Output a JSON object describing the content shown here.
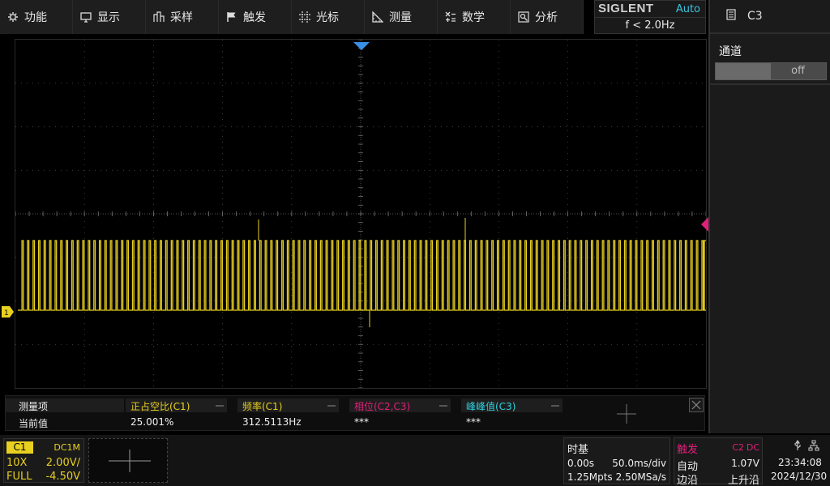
{
  "menu": {
    "items": [
      {
        "label": "功能",
        "icon": "gear-icon"
      },
      {
        "label": "显示",
        "icon": "monitor-icon"
      },
      {
        "label": "采样",
        "icon": "acquire-icon"
      },
      {
        "label": "触发",
        "icon": "flag-icon"
      },
      {
        "label": "光标",
        "icon": "cursor-icon"
      },
      {
        "label": "测量",
        "icon": "ruler-icon"
      },
      {
        "label": "数学",
        "icon": "math-icon"
      },
      {
        "label": "分析",
        "icon": "analysis-icon"
      }
    ]
  },
  "status": {
    "brand": "SIGLENT",
    "acq_mode": "Auto",
    "frequency": "f < 2.0Hz"
  },
  "right_panel": {
    "title": "C3",
    "icon": "document-icon",
    "section_label": "通道",
    "toggle_value": "off"
  },
  "colors": {
    "ch1": "#e8d020",
    "ch2": "#e0207a",
    "ch3": "#30d0e0",
    "trigger_marker": "#3a8ee6",
    "grid": "#555555"
  },
  "measurements": {
    "header_label": "测量项",
    "value_label": "当前值",
    "items": [
      {
        "name": "正占空比(C1)",
        "value": "25.001%",
        "color": "#e8d020"
      },
      {
        "name": "频率(C1)",
        "value": "312.5113Hz",
        "color": "#e8d020"
      },
      {
        "name": "相位(C2,C3)",
        "value": "***",
        "color": "#e0207a"
      },
      {
        "name": "峰峰值(C3)",
        "value": "***",
        "color": "#30d0e0"
      }
    ]
  },
  "channel1": {
    "name": "C1",
    "coupling": "DC1M",
    "probe": "10X",
    "scale": "2.00V/",
    "bandwidth": "FULL",
    "offset": "-4.50V"
  },
  "timebase": {
    "title": "时基",
    "delay": "0.00s",
    "scale": "50.0ms/div",
    "memory": "1.25Mpts",
    "sample_rate": "2.50MSa/s"
  },
  "trigger": {
    "title": "触发",
    "source": "C2",
    "coupling": "DC",
    "mode": "自动",
    "level": "1.07V",
    "type": "边沿",
    "slope": "上升沿"
  },
  "clock": {
    "time": "23:34:08",
    "date": "2024/12/30"
  }
}
